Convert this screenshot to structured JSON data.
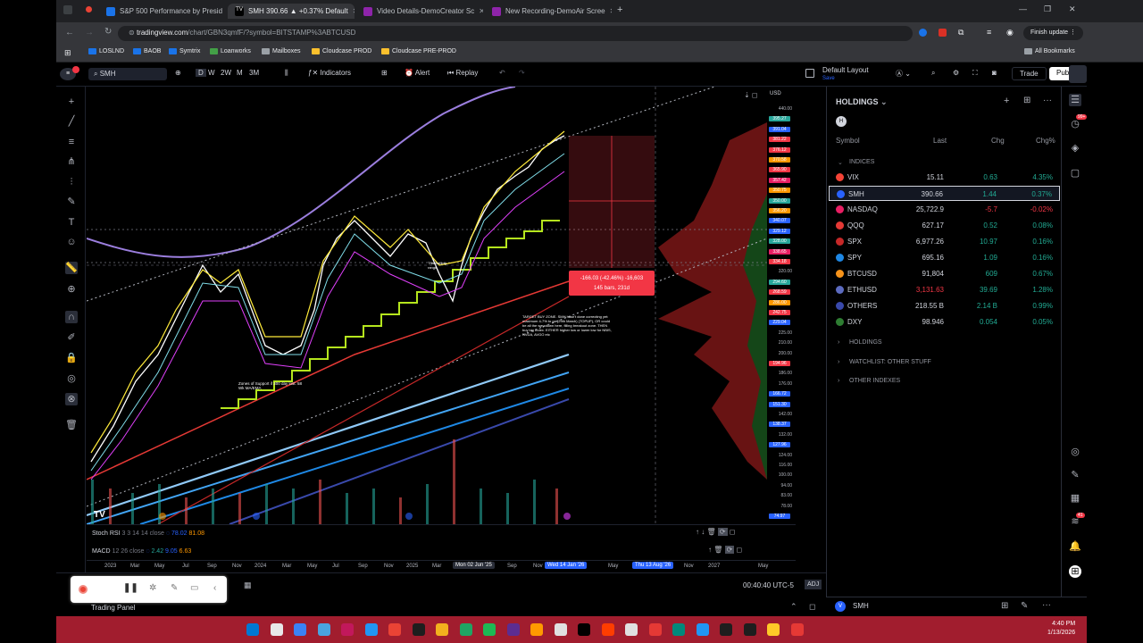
{
  "browser": {
    "tabs": [
      {
        "title": "S&P 500 Performance by Presid",
        "icon_color": "#1a73e8"
      },
      {
        "title": "SMH 390.66 ▲ +0.37% Default",
        "icon_color": "#2962ff"
      },
      {
        "title": "Video Details-DemoCreator Sc",
        "icon_color": "#8e24aa"
      },
      {
        "title": "New Recording-DemoAir Scree",
        "icon_color": "#8e24aa"
      }
    ],
    "url_main": "tradingview.com",
    "url_rest": "/chart/GBN3qmfF/?symbol=BITSTAMP%3ABTCUSD",
    "finish_update": "Finish update",
    "bookmarks": [
      "LOSLND",
      "BAOB",
      "Symtrix",
      "Loanworks",
      "Mailboxes",
      "Cloudcase PROD",
      "Cloudcase PRE-PROD"
    ],
    "all_bookmarks": "All Bookmarks"
  },
  "toolbar": {
    "symbol": "SMH",
    "intervals": [
      "D",
      "W",
      "2W",
      "M",
      "3M"
    ],
    "indicators": "Indicators",
    "alert": "Alert",
    "replay": "Replay",
    "layout": "Default Layout",
    "layout_sub": "Save",
    "trade": "Trade",
    "publish": "Publish"
  },
  "chart": {
    "currency": "USD",
    "price_labels": [
      "440.00",
      "395.27",
      "391.04",
      "381.22",
      "376.12",
      "370.58",
      "365.90",
      "357.42",
      "350.75",
      "350.00",
      "356.20",
      "340.07",
      "329.12",
      "328.00",
      "338.65",
      "334.18",
      "320.00",
      "294.60",
      "268.59",
      "286.00",
      "242.75",
      "229.04",
      "225.00",
      "210.00",
      "200.00",
      "194.96",
      "186.00",
      "176.00",
      "166.72",
      "151.30",
      "142.00",
      "138.37",
      "132.00",
      "127.96",
      "124.00",
      "116.00",
      "100.00",
      "94.00",
      "83.00",
      "78.00",
      "74.97"
    ],
    "measure_line1": "-166.03 (-42.46%) -16,603",
    "measure_line2": "145 bars, 231d",
    "annotation_target": "TARGET BUY ZONE. SMH hasn't done correcting yet: maximum 4-7% to go (29th March) (TOPUP), OR could be all the way down here, filling breakout zone. THEN buy big Index. EITHER higher low or lower low for NBIS, NVDA, AVGO etc",
    "annotation_support": "Zones of Support if 300 day lost: 58 Wk MA/EMA",
    "annotation_small": "This trading range"
  },
  "indicators": {
    "stoch_label": "Stoch RSI",
    "stoch_params": "3 3 14 14 close",
    "stoch_v1": "78.02",
    "stoch_v2": "81.08",
    "macd_label": "MACD",
    "macd_params": "12 26 close",
    "macd_v1": "2.42",
    "macd_v2": "9.05",
    "macd_v3": "6.63"
  },
  "time_axis": {
    "labels": [
      "2023",
      "Mar",
      "May",
      "Jul",
      "Sep",
      "Nov",
      "2024",
      "Mar",
      "May",
      "Jul",
      "Sep",
      "Nov",
      "2025",
      "Mar",
      "Sep",
      "Nov",
      "May",
      "Nov",
      "2027",
      "May"
    ],
    "highlight1": "Mon 02 Jun '25",
    "highlight2": "Wed 14 Jan '26",
    "highlight3": "Thu 13 Aug '26"
  },
  "bottom": {
    "clock": "00:40:40 UTC-5",
    "adj": "ADJ",
    "trading_panel": "Trading Panel"
  },
  "watchlist": {
    "title": "HOLDINGS",
    "col_symbol": "Symbol",
    "col_last": "Last",
    "col_chg": "Chg",
    "col_chgp": "Chg%",
    "section": "INDICES",
    "rows": [
      {
        "sym": "VIX",
        "last": "15.11",
        "chg": "0.63",
        "chgp": "4.35%",
        "dir": "pos",
        "color": "#f44336"
      },
      {
        "sym": "SMH",
        "last": "390.66",
        "chg": "1.44",
        "chgp": "0.37%",
        "dir": "pos",
        "color": "#2962ff"
      },
      {
        "sym": "NASDAQ",
        "last": "25,722.9",
        "chg": "-5.7",
        "chgp": "-0.02%",
        "dir": "neg",
        "color": "#e91e63"
      },
      {
        "sym": "QQQ",
        "last": "627.17",
        "chg": "0.52",
        "chgp": "0.08%",
        "dir": "pos",
        "color": "#e53935"
      },
      {
        "sym": "SPX",
        "last": "6,977.26",
        "chg": "10.97",
        "chgp": "0.16%",
        "dir": "pos",
        "color": "#c62828"
      },
      {
        "sym": "SPY",
        "last": "695.16",
        "chg": "1.09",
        "chgp": "0.16%",
        "dir": "pos",
        "color": "#1e88e5"
      },
      {
        "sym": "BTCUSD",
        "last": "91,804",
        "chg": "609",
        "chgp": "0.67%",
        "dir": "pos",
        "color": "#f7931a"
      },
      {
        "sym": "ETHUSD",
        "last": "3,131.63",
        "chg": "39.69",
        "chgp": "1.28%",
        "dir": "pos",
        "color": "#5c6bc0",
        "lastcolor": "#f23645"
      },
      {
        "sym": "OTHERS",
        "last": "218.55 B",
        "chg": "2.14 B",
        "chgp": "0.99%",
        "dir": "pos",
        "color": "#3949ab"
      },
      {
        "sym": "DXY",
        "last": "98.946",
        "chg": "0.054",
        "chgp": "0.05%",
        "dir": "pos",
        "color": "#2e7d32"
      }
    ],
    "groups": [
      "HOLDINGS",
      "WATCHLIST: OTHER STUFF",
      "OTHER INDEXES"
    ],
    "bottom_symbol": "SMH"
  },
  "taskbar": {
    "time": "4:40 PM",
    "date": "1/13/2026"
  }
}
